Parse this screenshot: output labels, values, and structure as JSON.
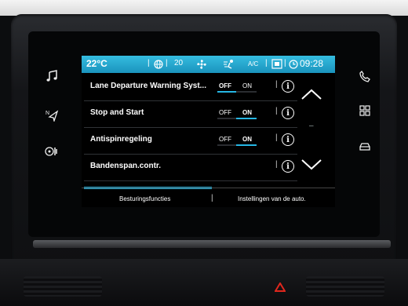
{
  "status_bar": {
    "temperature": "22°C",
    "fan_level": "20",
    "ac_label": "A/C",
    "time": "09:28"
  },
  "settings": [
    {
      "label": "Lane Departure Warning Syst...",
      "off": "OFF",
      "on": "ON",
      "state": "off"
    },
    {
      "label": "Stop and Start",
      "off": "OFF",
      "on": "ON",
      "state": "on"
    },
    {
      "label": "Antispinregeling",
      "off": "OFF",
      "on": "ON",
      "state": "on"
    },
    {
      "label": "Bandenspan.contr.",
      "off": "",
      "on": "",
      "state": "none"
    }
  ],
  "info_glyph": "i",
  "separator_glyph": "|",
  "scroll_mid": "–",
  "tabs": [
    {
      "label": "Besturingsfuncties",
      "active": true
    },
    {
      "label": "Instellingen van de auto.",
      "active": false
    }
  ],
  "tab_separator": "|",
  "side_buttons": {
    "left": [
      "music-icon",
      "navigation-icon",
      "climate-icon"
    ],
    "right": [
      "phone-icon",
      "apps-icon",
      "car-icon"
    ]
  },
  "colors": {
    "accent": "#26b7e4",
    "status_bar": "#1fa6d0",
    "text": "#ffffff"
  }
}
